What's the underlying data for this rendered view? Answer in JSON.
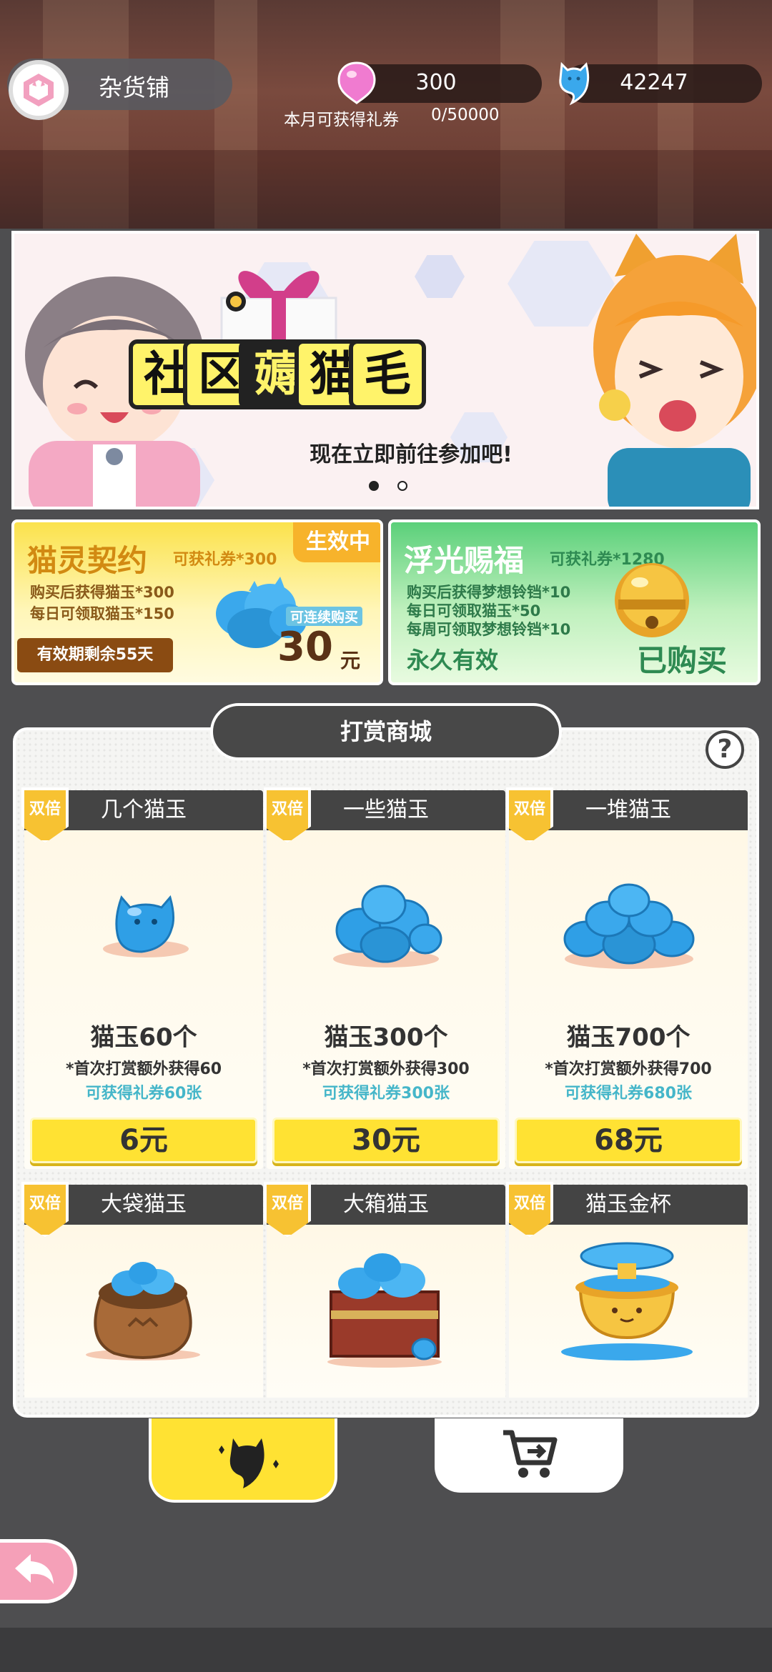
{
  "header": {
    "shop_title": "杂货铺",
    "ticket_balance": "300",
    "gem_balance": "42247",
    "monthly_label": "本月可获得礼券",
    "monthly_value": "0/50000"
  },
  "banner": {
    "title_chars": [
      "社",
      "区",
      "薅",
      "猫",
      "毛"
    ],
    "subtitle": "现在立即前往参加吧!",
    "page_count": 2,
    "active_page": 0
  },
  "promos": {
    "left": {
      "title": "猫灵契约",
      "reward": "可获礼券*300",
      "status": "生效中",
      "lines": [
        "购买后获得猫玉*300",
        "每日可领取猫玉*150"
      ],
      "validity": "有效期剩余55天",
      "repeat": "可连续购买",
      "price_num": "30",
      "price_unit": "元"
    },
    "right": {
      "title": "浮光赐福",
      "reward": "可获礼券*1280",
      "lines": [
        "购买后获得梦想铃铛*10",
        "每日可领取猫玉*50",
        "每周可领取梦想铃铛*10"
      ],
      "validity": "永久有效",
      "status": "已购买"
    }
  },
  "store": {
    "title": "打赏商城",
    "help": "?",
    "badge": "双倍",
    "items": [
      {
        "name": "几个猫玉",
        "amount": "猫玉60个",
        "bonus": "*首次打赏额外获得60",
        "tickets": "可获得礼券60张",
        "price": "6元"
      },
      {
        "name": "一些猫玉",
        "amount": "猫玉300个",
        "bonus": "*首次打赏额外获得300",
        "tickets": "可获得礼券300张",
        "price": "30元"
      },
      {
        "name": "一堆猫玉",
        "amount": "猫玉700个",
        "bonus": "*首次打赏额外获得700",
        "tickets": "可获得礼券680张",
        "price": "68元"
      },
      {
        "name": "大袋猫玉"
      },
      {
        "name": "大箱猫玉"
      },
      {
        "name": "猫玉金杯"
      }
    ]
  },
  "colors": {
    "accent_yellow": "#ffe233",
    "ticket_pink": "#f07bd0",
    "gem_blue": "#3aa8ec",
    "ticket_text": "#45b6c9"
  }
}
